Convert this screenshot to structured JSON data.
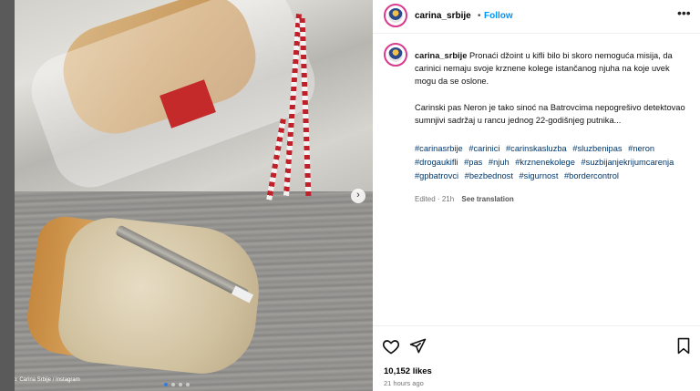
{
  "post": {
    "photo_credit": "Foto: Carina Srbije / Instagram",
    "slide_count": 4,
    "active_slide": 1,
    "header": {
      "username": "carina_srbije",
      "separator": "•",
      "follow_label": "Follow",
      "more_icon": "more-horizontal-icon"
    },
    "caption": {
      "username": "carina_srbije",
      "paragraph1": "Pronaći džoint u kifli bilo bi skoro nemoguća misija, da carinici nemaju svoje krznene kolege istančanog njuha na koje uvek mogu da se oslone.",
      "paragraph2": "Carinski pas Neron je tako sinoć na Batrovcima nepogrešivo detektovao sumnjivi sadržaj u rancu jednog 22-godišnjeg putnika...",
      "hashtags": [
        "#carinasrbije",
        "#carinici",
        "#carinskasluzba",
        "#sluzbenipas",
        "#neron",
        "#drogaukifli",
        "#pas",
        "#njuh",
        "#krznenekolege",
        "#suzbijanjekrijumcarenja",
        "#gpbatrovci",
        "#bezbednost",
        "#sigurnost",
        "#bordercontrol"
      ],
      "edited_label": "Edited",
      "age": "21h",
      "see_translation": "See translation"
    },
    "likes": "10,152 likes",
    "timestamp": "21 hours ago"
  },
  "colors": {
    "follow": "#0095f6",
    "hashtag": "#00376b",
    "avatar_ring": "#d93a8e",
    "meta_gray": "#737373"
  }
}
